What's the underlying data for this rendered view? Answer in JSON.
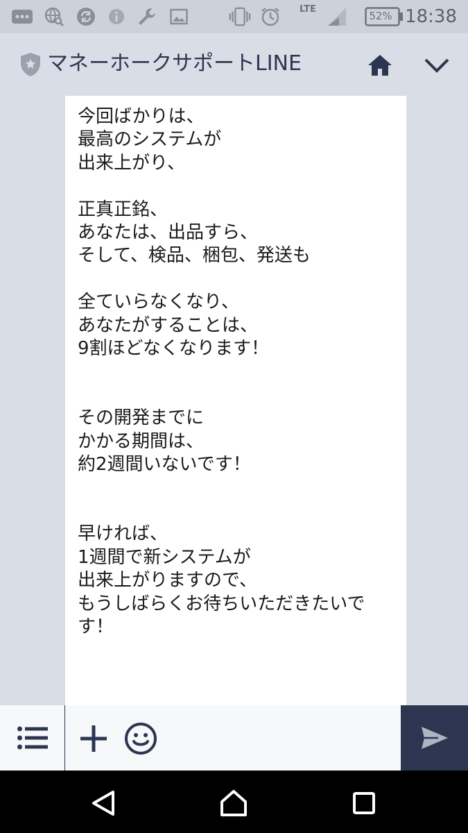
{
  "status_bar": {
    "network": "LTE",
    "battery": "52%",
    "time": "18:38",
    "icons": [
      "more-icon",
      "globe-search-icon",
      "sync-icon",
      "info-icon",
      "wrench-icon",
      "image-icon",
      "vibrate-icon",
      "alarm-icon",
      "signal-icon",
      "battery-icon"
    ]
  },
  "header": {
    "title": "マネーホークサポートLINE",
    "icons": [
      "verified-shield-icon",
      "home-icon",
      "chevron-down-icon"
    ]
  },
  "message": {
    "text": "今回ばかりは、\n最高のシステムが\n出来上がり、\n\n正真正銘、\nあなたは、出品すら、\nそして、検品、梱包、発送も\n\n全ていらなくなり、\nあなたがすることは、\n9割ほどなくなります！\n\n\nその開発までに\nかかる期間は、\n約2週間いないです！\n\n\n早ければ、\n1週間で新システムが\n出来上がりますので、\nもうしばらくお待ちいただきたいです！"
  },
  "input_bar": {
    "placeholder": "",
    "icons": [
      "menu-icon",
      "plus-icon",
      "emoji-icon",
      "send-icon"
    ]
  },
  "nav_bar": {
    "icons": [
      "back-icon",
      "home-icon",
      "recents-icon"
    ]
  },
  "colors": {
    "background": "#d9dde6",
    "status_bar": "#cdd1da",
    "header_text": "#2c3650",
    "bubble": "#ffffff",
    "send_button": "#2c3650",
    "nav_bar": "#000000"
  }
}
